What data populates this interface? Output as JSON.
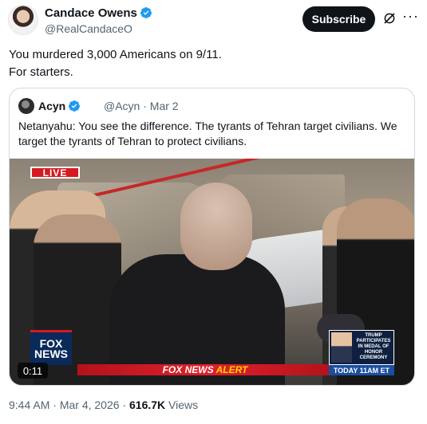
{
  "author": {
    "name": "Candace Owens",
    "handle": "@RealCandaceO",
    "verified": true
  },
  "actions": {
    "subscribe_label": "Subscribe",
    "grok_icon": "grok-slash-icon",
    "more_icon": "more-dots-icon"
  },
  "post": {
    "lines": [
      "You murdered 3,000 Americans on 9/11.",
      "For starters."
    ]
  },
  "quote": {
    "name": "Acyn",
    "handle": "@Acyn",
    "separator": "·",
    "date": "Mar 2",
    "text": "Netanyahu: You see the difference. The tyrants of Tehran target civilians. We target the tyrants of Tehran to protect civilians.",
    "video": {
      "live_label": "LIVE",
      "duration": "0:11",
      "alert_prefix": "FOX NEWS",
      "alert_word": "ALERT",
      "fox_logo_top": "FOX",
      "fox_logo_bottom": "NEWS",
      "promo_text": "TRUMP PARTICIPATES IN MEDAL OF HONOR CEREMONY",
      "promo_time": "TODAY 11AM ET"
    }
  },
  "meta": {
    "time": "9:44 AM",
    "date": "Mar 4, 2026",
    "separator": "·",
    "views_count": "616.7K",
    "views_label": "Views"
  },
  "colors": {
    "text": "#0f1419",
    "secondary": "#536471",
    "verified": "#1d9bf0",
    "border": "#cfd9de",
    "fox_red": "#d71921"
  }
}
